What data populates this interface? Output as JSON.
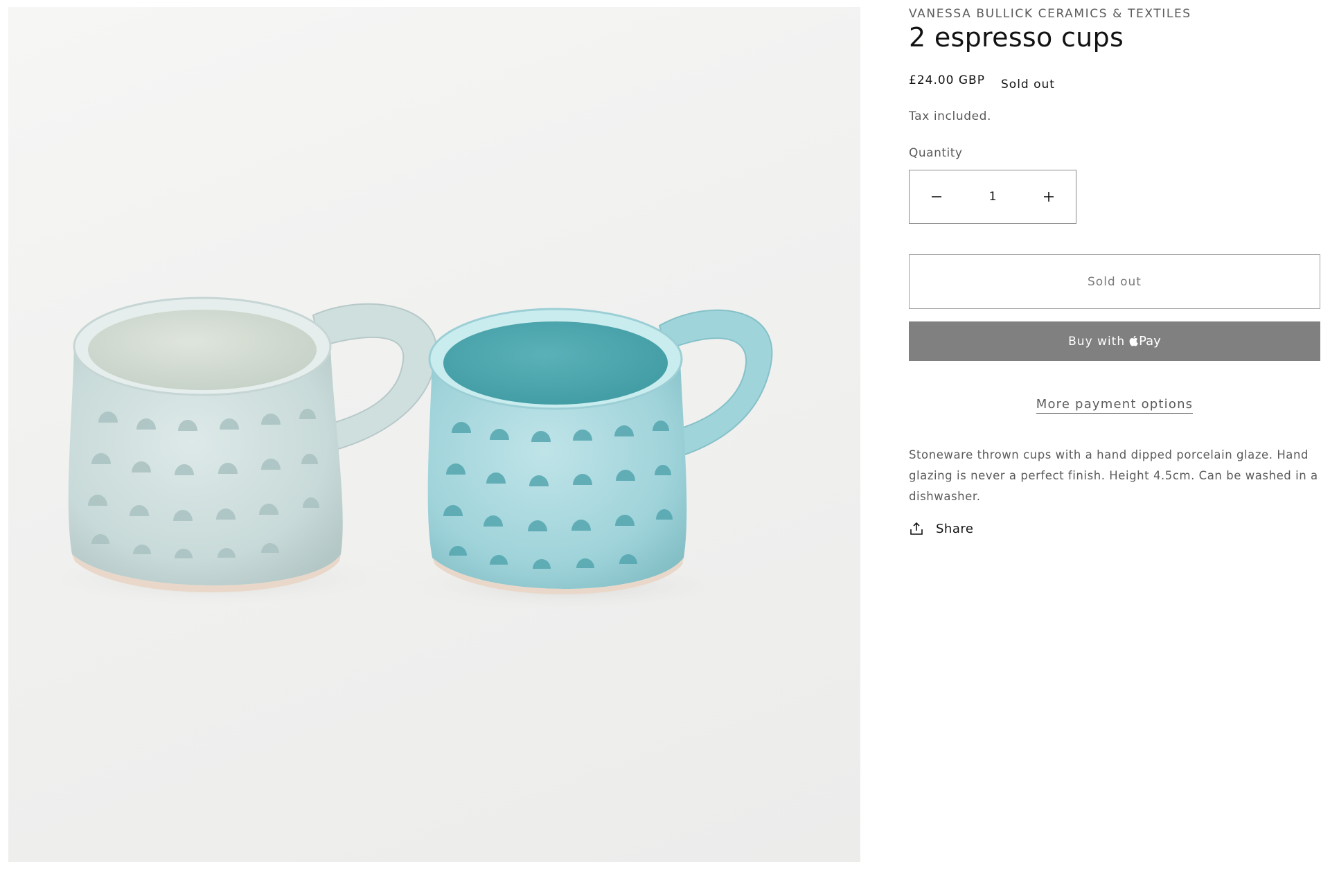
{
  "product": {
    "vendor": "VANESSA BULLICK CERAMICS & TEXTILES",
    "title": "2 espresso cups",
    "price": "£24.00 GBP",
    "badge": "Sold out",
    "tax_note": "Tax included.",
    "description": "Stoneware thrown cups with a hand dipped porcelain glaze. Hand glazing is never a perfect finish. Height 4.5cm.  Can be washed in a dishwasher."
  },
  "quantity": {
    "label": "Quantity",
    "value": "1",
    "decrease_icon": "minus-icon",
    "increase_icon": "plus-icon"
  },
  "buttons": {
    "add_to_cart": "Sold out",
    "buy_with": "Buy with",
    "pay_brand": "Pay",
    "pay_icon": "apple-logo-icon",
    "more_payment": "More payment options"
  },
  "share": {
    "label": "Share",
    "icon": "share-icon"
  },
  "colors": {
    "buy_button_bg": "#808080",
    "text_primary": "#121212",
    "text_secondary": "#5b5b5b",
    "cup_left_glaze": "#c9dcdb",
    "cup_right_glaze": "#8fcfd6"
  }
}
